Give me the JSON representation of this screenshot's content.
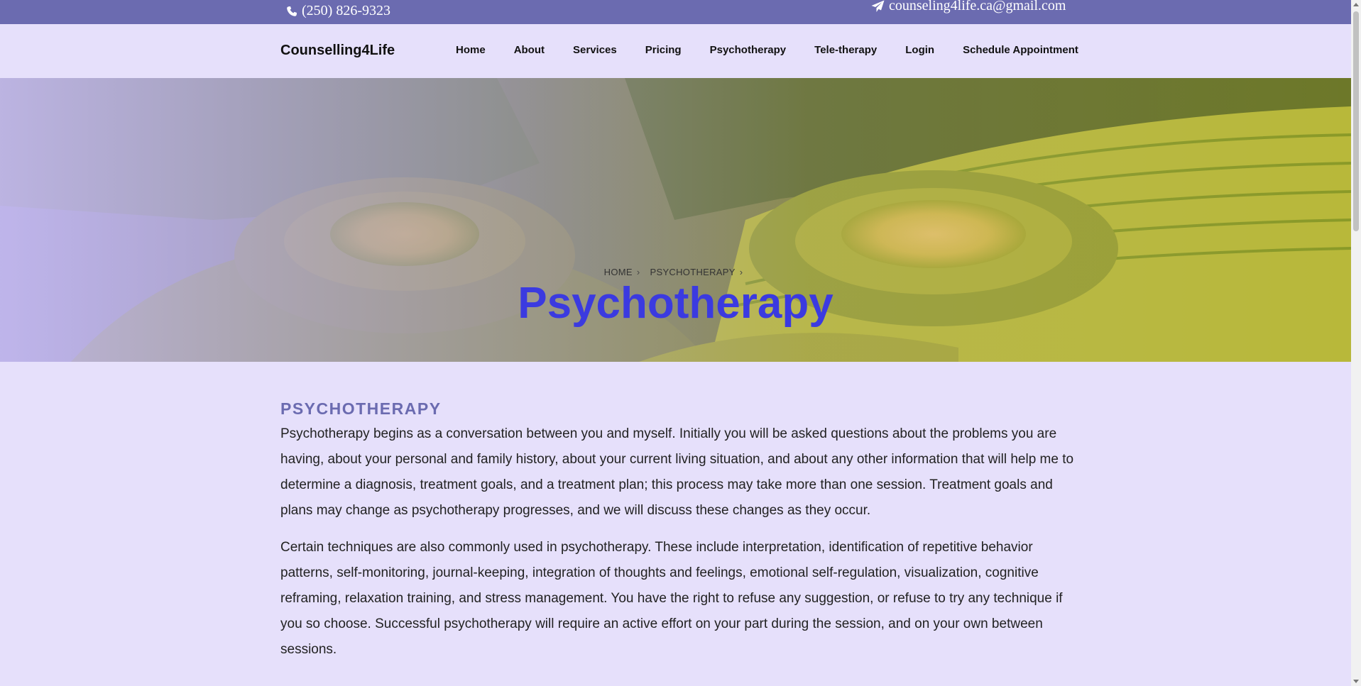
{
  "topbar": {
    "phone": "(250) 826-9323",
    "email": "counseling4life.ca@gmail.com",
    "phone_icon": "phone-icon",
    "email_icon": "paper-plane-icon"
  },
  "brand": "Counselling4Life",
  "nav": {
    "items": [
      "Home",
      "About",
      "Services",
      "Pricing",
      "Psychotherapy",
      "Tele-therapy",
      "Login",
      "Schedule Appointment"
    ]
  },
  "hero": {
    "breadcrumb": [
      "HOME",
      "PSYCHOTHERAPY"
    ],
    "title": "Psychotherapy"
  },
  "content": {
    "heading": "PSYCHOTHERAPY",
    "paragraphs": [
      "Psychotherapy begins as a conversation between you and myself. Initially you will be asked questions about the problems you are having, about your personal and family history, about your current living situation, and about any other information that will help me to determine a diagnosis, treatment goals, and a treatment plan; this process may take more than one session. Treatment goals and plans may change as psychotherapy progresses, and we will discuss these changes as they occur.",
      "Certain techniques are also commonly used in psychotherapy. These include interpretation, identification of repetitive behavior patterns, self-monitoring, journal-keeping, integration of thoughts and feelings, emotional self-regulation, visualization, cognitive reframing, relaxation training, and stress management. You have the right to refuse any suggestion, or refuse to try any technique if you so choose. Successful psychotherapy will require an active effort on your part during the session, and on your own between sessions."
    ]
  },
  "colors": {
    "topbar": "#6b6bb0",
    "page_bg": "#e6e0fb",
    "title": "#3b3ae0",
    "heading": "#6b6bb0"
  }
}
